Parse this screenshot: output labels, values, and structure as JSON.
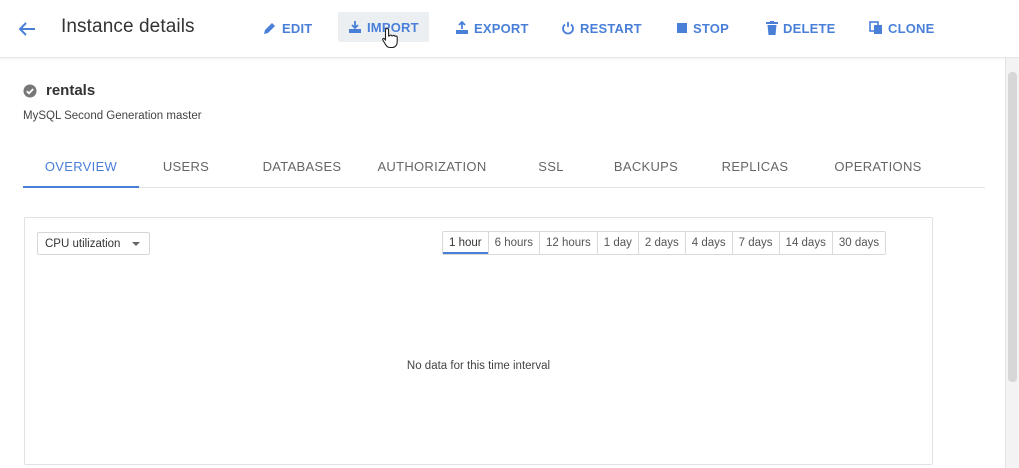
{
  "header": {
    "title": "Instance details",
    "actions": [
      {
        "label": "EDIT"
      },
      {
        "label": "IMPORT"
      },
      {
        "label": "EXPORT"
      },
      {
        "label": "RESTART"
      },
      {
        "label": "STOP"
      },
      {
        "label": "DELETE"
      },
      {
        "label": "CLONE"
      }
    ]
  },
  "instance": {
    "name": "rentals",
    "subtitle": "MySQL Second Generation master",
    "status_icon": "check-circle-icon"
  },
  "tabs": [
    {
      "label": "OVERVIEW",
      "active": true
    },
    {
      "label": "USERS"
    },
    {
      "label": "DATABASES"
    },
    {
      "label": "AUTHORIZATION"
    },
    {
      "label": "SSL"
    },
    {
      "label": "BACKUPS"
    },
    {
      "label": "REPLICAS"
    },
    {
      "label": "OPERATIONS"
    }
  ],
  "chart_panel": {
    "metric_selected": "CPU utilization",
    "time_ranges": [
      "1 hour",
      "6 hours",
      "12 hours",
      "1 day",
      "2 days",
      "4 days",
      "7 days",
      "14 days",
      "30 days"
    ],
    "active_range": "1 hour",
    "empty_message": "No data for this time interval"
  },
  "colors": {
    "accent": "#4a7fd8",
    "text": "#333333",
    "muted": "#666666"
  }
}
